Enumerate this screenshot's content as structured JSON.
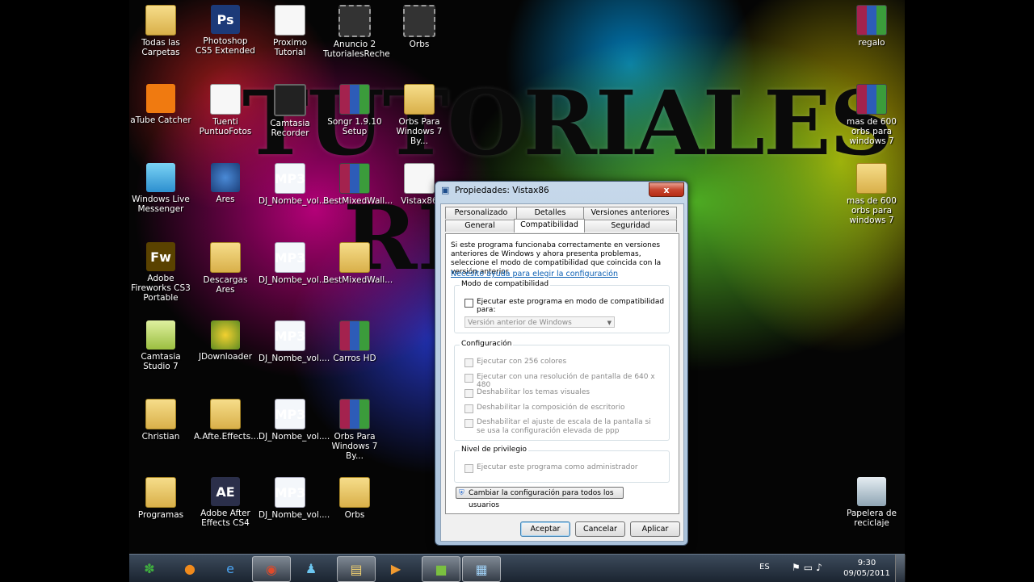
{
  "wallpaper": {
    "line1": "TUTORIALES",
    "line2": "RE"
  },
  "desktop_icons": [
    {
      "label": "Todas las Carpetas",
      "icon": "folder-icon"
    },
    {
      "label": "Photoshop CS5 Extended",
      "icon": "photoshop-icon",
      "glyph": "Ps"
    },
    {
      "label": "Proximo Tutorial",
      "icon": "document-icon"
    },
    {
      "label": "Anuncio 2 TutorialesReche",
      "icon": "video-icon"
    },
    {
      "label": "Orbs",
      "icon": "film-folder-icon"
    },
    {
      "label": "regalo",
      "icon": "winrar-icon"
    },
    {
      "label": "aTube Catcher",
      "icon": "atube-catcher-icon"
    },
    {
      "label": "Tuenti PuntuoFotos",
      "icon": "document-icon"
    },
    {
      "label": "Camtasia Recorder",
      "icon": "camera-icon"
    },
    {
      "label": "Songr 1.9.10 Setup",
      "icon": "winrar-icon"
    },
    {
      "label": "Orbs Para Windows 7 By...",
      "icon": "folder-icon"
    },
    {
      "label": "mas de 600 orbs para windows 7",
      "icon": "winrar-icon"
    },
    {
      "label": "Windows Live Messenger",
      "icon": "messenger-icon"
    },
    {
      "label": "Ares",
      "icon": "ares-icon"
    },
    {
      "label": "DJ_Nombe_vol....",
      "icon": "mp3-icon",
      "glyph": "MP3"
    },
    {
      "label": "BestMixedWall...",
      "icon": "winrar-icon"
    },
    {
      "label": "Vistax86",
      "icon": "monitor-icon"
    },
    {
      "label": "mas de 600 orbs para windows 7",
      "icon": "folder-icon"
    },
    {
      "label": "Adobe Fireworks CS3 Portable",
      "icon": "fireworks-icon",
      "glyph": "Fw"
    },
    {
      "label": "Descargas Ares",
      "icon": "folder-icon"
    },
    {
      "label": "DJ_Nombe_vol....",
      "icon": "mp3-icon",
      "glyph": "MP3"
    },
    {
      "label": "BestMixedWall...",
      "icon": "folder-icon"
    },
    {
      "label": "Camtasia Studio 7",
      "icon": "camtasia-icon"
    },
    {
      "label": "JDownloader",
      "icon": "jdownloader-icon"
    },
    {
      "label": "DJ_Nombe_vol....",
      "icon": "mp3-icon",
      "glyph": "MP3"
    },
    {
      "label": "Carros HD",
      "icon": "winrar-icon"
    },
    {
      "label": "Christian",
      "icon": "user-folder-icon"
    },
    {
      "label": "A.Afte.Effects....",
      "icon": "folder-icon"
    },
    {
      "label": "DJ_Nombe_vol....",
      "icon": "mp3-icon",
      "glyph": "MP3"
    },
    {
      "label": "Orbs Para Windows 7 By...",
      "icon": "winrar-icon"
    },
    {
      "label": "Programas",
      "icon": "folder-icon"
    },
    {
      "label": "Adobe After Effects CS4",
      "icon": "after-effects-icon",
      "glyph": "AE"
    },
    {
      "label": "DJ_Nombe_vol....",
      "icon": "mp3-icon",
      "glyph": "MP3"
    },
    {
      "label": "Orbs",
      "icon": "folder-icon"
    },
    {
      "label": "Papelera de reciclaje",
      "icon": "recycle-bin-icon"
    }
  ],
  "taskbar": {
    "apps": [
      "weed-orb-icon",
      "firefox-icon",
      "internet-explorer-icon",
      "chrome-icon",
      "messenger-icon",
      "explorer-icon",
      "media-player-icon",
      "camtasia-icon",
      "control-panel-icon"
    ],
    "language": "ES",
    "time": "9:30",
    "date": "09/05/2011"
  },
  "dialog": {
    "title": "Propiedades: Vistax86",
    "close_label": "x",
    "tabs_row1": [
      "Personalizado",
      "Detalles",
      "Versiones anteriores"
    ],
    "tabs_row2": [
      "General",
      "Compatibilidad",
      "Seguridad"
    ],
    "active_tab": "Compatibilidad",
    "description": "Si este programa funcionaba correctamente en versiones anteriores de Windows y ahora presenta problemas, seleccione el modo de compatibilidad que coincida con la versión anterior.",
    "help_link": "Necesito ayuda para elegir la configuración",
    "compat_group": {
      "title": "Modo de compatibilidad",
      "checkbox": "Ejecutar este programa en modo de compatibilidad para:",
      "select_value": "Versión anterior de Windows"
    },
    "config_group": {
      "title": "Configuración",
      "options": [
        "Ejecutar con 256 colores",
        "Ejecutar con una resolución de pantalla de 640 x 480",
        "Deshabilitar los temas visuales",
        "Deshabilitar la composición de escritorio",
        "Deshabilitar el ajuste de escala de la pantalla si se usa la configuración elevada de ppp"
      ]
    },
    "privilege_group": {
      "title": "Nivel de privilegio",
      "checkbox": "Ejecutar este programa como administrador"
    },
    "all_users_button": "Cambiar la configuración para todos los usuarios",
    "buttons": {
      "ok": "Aceptar",
      "cancel": "Cancelar",
      "apply": "Aplicar"
    }
  }
}
